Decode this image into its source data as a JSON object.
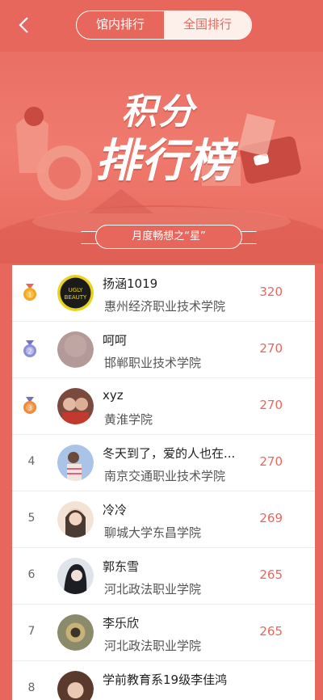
{
  "header": {
    "tabs": [
      {
        "label": "馆内排行",
        "active": false
      },
      {
        "label": "全国排行",
        "active": true
      }
    ]
  },
  "banner": {
    "title_line1": "积分",
    "title_line2": "排行榜",
    "subtitle": "月度畅想之“星”"
  },
  "colors": {
    "accent": "#e8675c",
    "gold": "#f5a623",
    "silver": "#8a8fd6"
  },
  "ranking": [
    {
      "rank": "1",
      "medal": "gold",
      "name": "扬涵1019",
      "school": "惠州经济职业技术学院",
      "score": "320"
    },
    {
      "rank": "2",
      "medal": "silver",
      "name": "呵呵",
      "school": "邯郸职业技术学院",
      "score": "270"
    },
    {
      "rank": "3",
      "medal": "bronze",
      "name": "xyz",
      "school": "黄淮学院",
      "score": "270"
    },
    {
      "rank": "4",
      "medal": "",
      "name": "冬天到了，爱的人也在...",
      "school": "南京交通职业技术学院",
      "score": "270"
    },
    {
      "rank": "5",
      "medal": "",
      "name": "冷冷",
      "school": "聊城大学东昌学院",
      "score": "269"
    },
    {
      "rank": "6",
      "medal": "",
      "name": "郭东雪",
      "school": "河北政法职业学院",
      "score": "265"
    },
    {
      "rank": "7",
      "medal": "",
      "name": "李乐欣",
      "school": "河北政法职业学院",
      "score": "265"
    },
    {
      "rank": "8",
      "medal": "",
      "name": "学前教育系19级李佳鸿",
      "school": "",
      "score": ""
    }
  ]
}
